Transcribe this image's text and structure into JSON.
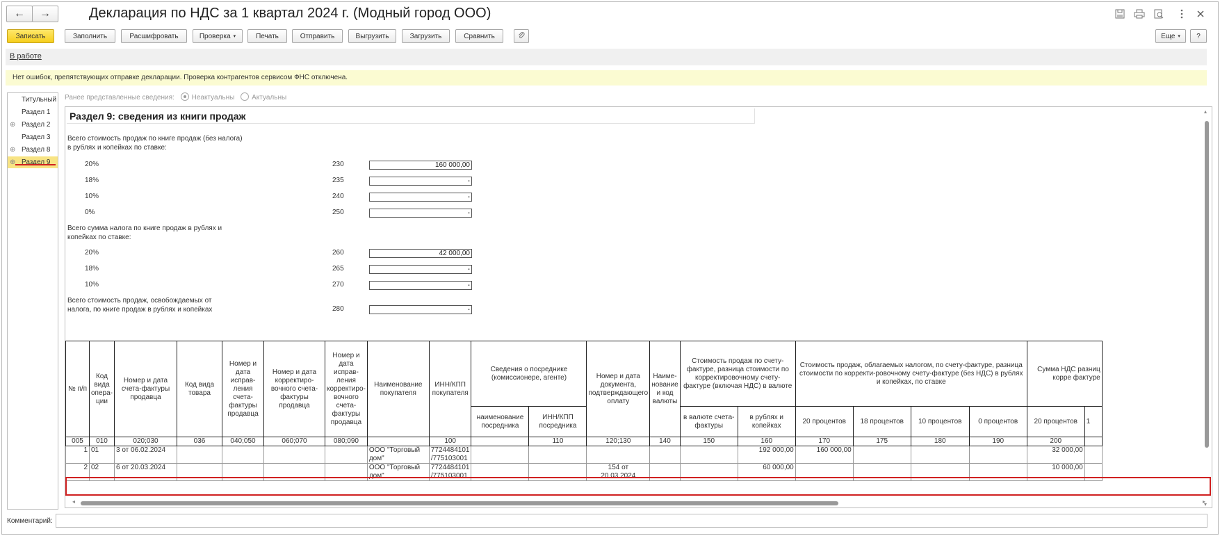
{
  "window": {
    "title": "Декларация по НДС за 1 квартал 2024 г. (Модный город ООО)",
    "nav_back": "←",
    "nav_forward": "→",
    "icons": [
      "save-icon",
      "print-icon",
      "preview-icon",
      "more-icon",
      "close-icon"
    ]
  },
  "toolbar": {
    "save": "Записать",
    "fill": "Заполнить",
    "decode": "Расшифровать",
    "check": "Проверка",
    "print": "Печать",
    "send": "Отправить",
    "export": "Выгрузить",
    "import": "Загрузить",
    "compare": "Сравнить",
    "more": "Еще",
    "help": "?"
  },
  "status": {
    "link": "В работе"
  },
  "info": {
    "message": "Нет ошибок, препятствующих отправке декларации. Проверка контрагентов сервисом ФНС отключена."
  },
  "sidebar": {
    "items": [
      {
        "label": "Титульный",
        "expandable": false,
        "selected": false
      },
      {
        "label": "Раздел 1",
        "expandable": false,
        "selected": false
      },
      {
        "label": "Раздел 2",
        "expandable": true,
        "selected": false
      },
      {
        "label": "Раздел 3",
        "expandable": false,
        "selected": false
      },
      {
        "label": "Раздел 8",
        "expandable": true,
        "selected": false
      },
      {
        "label": "Раздел 9",
        "expandable": true,
        "selected": true
      }
    ]
  },
  "previous": {
    "label": "Ранее представленные сведения:",
    "option1": "Неактуальны",
    "option2": "Актуальны",
    "selected": "Неактуальны"
  },
  "section": {
    "title": "Раздел 9: сведения из книги продаж",
    "sales_label_1": "Всего стоимость продаж по книге продаж (без налога)",
    "sales_label_2": "в рублях и копейках по ставке:",
    "tax_label_1": "Всего сумма налога по книге продаж в рублях и",
    "tax_label_2": "копейках по ставке:",
    "exempt_label_1": "Всего стоимость продаж, освобождаемых от",
    "exempt_label_2": "налога, по книге продаж в рублях и копейках",
    "sales_rows": [
      {
        "rate": "20%",
        "code": "230",
        "value": "160 000,00"
      },
      {
        "rate": "18%",
        "code": "235",
        "value": "-"
      },
      {
        "rate": "10%",
        "code": "240",
        "value": "-"
      },
      {
        "rate": "0%",
        "code": "250",
        "value": "-"
      }
    ],
    "tax_rows": [
      {
        "rate": "20%",
        "code": "260",
        "value": "42 000,00"
      },
      {
        "rate": "18%",
        "code": "265",
        "value": "-"
      },
      {
        "rate": "10%",
        "code": "270",
        "value": "-"
      }
    ],
    "exempt_row": {
      "code": "280",
      "value": "-"
    }
  },
  "grid": {
    "headers": {
      "n": "№ п/п",
      "op_code": "Код вида опера-ции",
      "invoice": "Номер и дата счета-фактуры продавца",
      "goods_code": "Код вида товара",
      "corr_invoice": "Номер и дата исправ-ления счета-фактуры продавца",
      "adj_invoice": "Номер и дата корректиро-вочного счета-фактуры продавца",
      "corr_adj_invoice": "Номер и дата исправ-ления корректиро-вочного счета-фактуры продавца",
      "buyer": "Наименование покупателя",
      "buyer_inn": "ИНН/КПП покупателя",
      "agent": "Сведения о посреднике (комиссионере, агенте)",
      "agent_name": "наименование посредника",
      "agent_inn": "ИНН/КПП посредника",
      "payment_doc": "Номер и дата документа, подтверждающего оплату",
      "currency": "Наиме-нование и код валюты",
      "cost_incl_vat": "Стоимость продаж по счету-фактуре, разница стоимости по корректировочному счету-фактуре (включая НДС) в валюте",
      "in_currency": "в валюте счета-фактуры",
      "in_rubles": "в рублях и копейках",
      "taxable": "Стоимость продаж, облагаемых налогом, по счету-фактуре, разница стоимости по корректи-ровочному счету-фактуре (без НДС) в рублях и копейках, по ставке",
      "p20": "20 процентов",
      "p18": "18 процентов",
      "p10": "10 процентов",
      "p0": "0 процентов",
      "vat_sum": "Сумма НДС разниц корре фактуре",
      "vat20": "20 процентов",
      "vat_next": "1"
    },
    "codes": [
      "005",
      "010",
      "020;030",
      "036",
      "040;050",
      "060;070",
      "080;090",
      "",
      "100",
      "",
      "110",
      "120;130",
      "140",
      "150",
      "160",
      "170",
      "175",
      "180",
      "190",
      "200",
      ""
    ],
    "rows": [
      {
        "n": "1",
        "op": "01",
        "invoice": "3 от 06.02.2024",
        "buyer_1": "ООО \"Торговый",
        "buyer_2": "дом\"",
        "inn_1": "7724484101",
        "inn_2": "/775103001",
        "payment_1": "",
        "payment_2": "",
        "rub": "192 000,00",
        "p20": "160 000,00",
        "vat20": "32 000,00"
      },
      {
        "n": "2",
        "op": "02",
        "invoice": "6 от 20.03.2024",
        "buyer_1": "ООО \"Торговый",
        "buyer_2": "дом\"",
        "inn_1": "7724484101",
        "inn_2": "/775103001",
        "payment_1": "154 от",
        "payment_2": "20.03.2024",
        "rub": "60 000,00",
        "p20": "",
        "vat20": "10 000,00"
      }
    ]
  },
  "comment": {
    "label": "Комментарий:",
    "value": ""
  }
}
